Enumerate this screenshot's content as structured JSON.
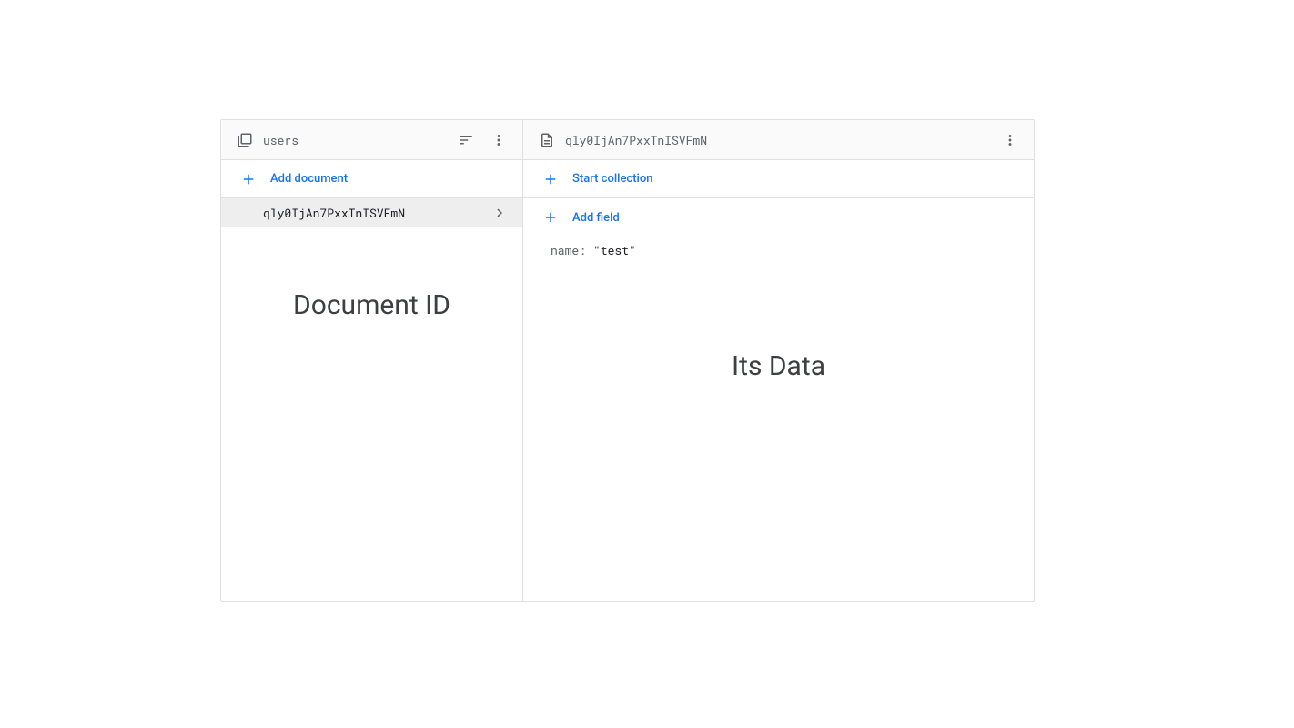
{
  "left_panel": {
    "header_title": "users",
    "add_document_label": "Add document",
    "documents": [
      {
        "id": "qly0IjAn7PxxTnISVFmN"
      }
    ],
    "annotation": "Document ID"
  },
  "right_panel": {
    "header_title": "qly0IjAn7PxxTnISVFmN",
    "start_collection_label": "Start collection",
    "add_field_label": "Add field",
    "fields": [
      {
        "key": "name",
        "value": "\"test\""
      }
    ],
    "annotation": "Its Data"
  }
}
